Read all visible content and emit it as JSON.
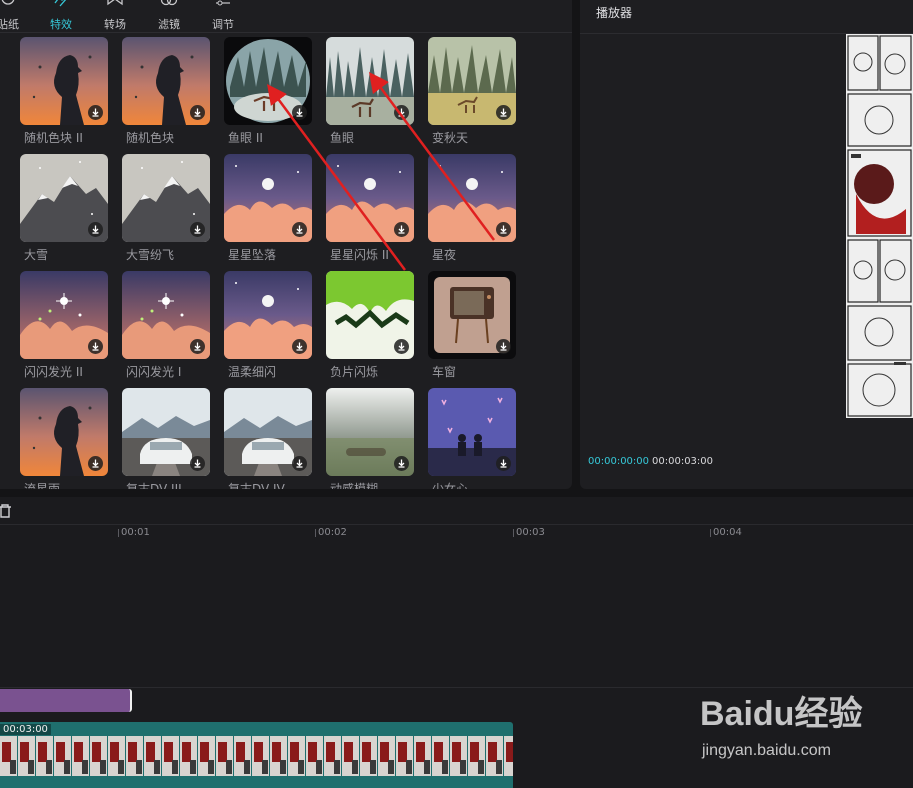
{
  "toolbar": {
    "items": [
      {
        "label": "贴纸",
        "icon": "sticker-icon"
      },
      {
        "label": "特效",
        "icon": "effects-icon",
        "active": true
      },
      {
        "label": "转场",
        "icon": "transition-icon"
      },
      {
        "label": "滤镜",
        "icon": "filter-icon"
      },
      {
        "label": "调节",
        "icon": "adjust-icon"
      }
    ]
  },
  "effects": [
    {
      "label": "随机色块 II",
      "scene": "silhouette"
    },
    {
      "label": "随机色块",
      "scene": "silhouette"
    },
    {
      "label": "鱼眼 II",
      "scene": "fisheye"
    },
    {
      "label": "鱼眼",
      "scene": "forest"
    },
    {
      "label": "变秋天",
      "scene": "autumn"
    },
    {
      "label": "大雪",
      "scene": "mountain"
    },
    {
      "label": "大雪纷飞",
      "scene": "mountain"
    },
    {
      "label": "星星坠落",
      "scene": "clouds"
    },
    {
      "label": "星星闪烁 II",
      "scene": "clouds"
    },
    {
      "label": "星夜",
      "scene": "clouds"
    },
    {
      "label": "闪闪发光 II",
      "scene": "sparkle"
    },
    {
      "label": "闪闪发光 I",
      "scene": "sparkle"
    },
    {
      "label": "温柔细闪",
      "scene": "clouds"
    },
    {
      "label": "负片闪烁",
      "scene": "negative"
    },
    {
      "label": "车窗",
      "scene": "tv"
    },
    {
      "label": "流星雨",
      "scene": "silhouette"
    },
    {
      "label": "复古DV III",
      "scene": "car"
    },
    {
      "label": "复古DV IV",
      "scene": "car"
    },
    {
      "label": "动感模糊",
      "scene": "blur"
    },
    {
      "label": "少女心",
      "scene": "couple"
    }
  ],
  "player": {
    "title": "播放器",
    "current_time": "00:00:00:00",
    "total_time": "00:00:03:00"
  },
  "timeline": {
    "ruler_labels": [
      "00:01",
      "00:02",
      "00:03",
      "00:04"
    ],
    "clip_duration": "00:03:00"
  },
  "watermark": {
    "logo": "Baidu经验",
    "url": "jingyan.baidu.com"
  },
  "colors": {
    "accent": "#36c8d8",
    "effect_clip": "#7a5290",
    "video_clip": "#1f6f6e",
    "arrow": "#e02020"
  }
}
